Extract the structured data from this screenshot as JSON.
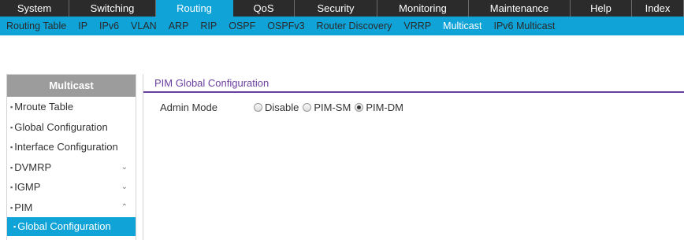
{
  "top_nav": {
    "tabs": [
      {
        "label": "System"
      },
      {
        "label": "Switching"
      },
      {
        "label": "Routing"
      },
      {
        "label": "QoS"
      },
      {
        "label": "Security"
      },
      {
        "label": "Monitoring"
      },
      {
        "label": "Maintenance"
      },
      {
        "label": "Help"
      },
      {
        "label": "Index"
      }
    ],
    "active": "Routing"
  },
  "sub_nav": {
    "items": [
      {
        "label": "Routing Table"
      },
      {
        "label": "IP"
      },
      {
        "label": "IPv6"
      },
      {
        "label": "VLAN"
      },
      {
        "label": "ARP"
      },
      {
        "label": "RIP"
      },
      {
        "label": "OSPF"
      },
      {
        "label": "OSPFv3"
      },
      {
        "label": "Router Discovery"
      },
      {
        "label": "VRRP"
      },
      {
        "label": "Multicast"
      },
      {
        "label": "IPv6 Multicast"
      }
    ],
    "active": "Multicast"
  },
  "sidebar": {
    "title": "Multicast",
    "items": [
      {
        "label": "Mroute Table",
        "chevron": ""
      },
      {
        "label": "Global Configuration",
        "chevron": ""
      },
      {
        "label": "Interface Configuration",
        "chevron": ""
      },
      {
        "label": "DVMRP",
        "chevron": "⌄"
      },
      {
        "label": "IGMP",
        "chevron": "⌄"
      },
      {
        "label": "PIM",
        "chevron": "⌃"
      },
      {
        "label": "Global Configuration",
        "chevron": ""
      }
    ]
  },
  "main": {
    "section_title": "PIM Global Configuration",
    "admin_mode": {
      "label": "Admin Mode",
      "options": [
        "Disable",
        "PIM-SM",
        "PIM-DM"
      ],
      "selected": "PIM-DM"
    }
  },
  "colors": {
    "accent": "#0fa3d8",
    "nav_bg": "#2b2b2b",
    "section_title": "#6b3fa0",
    "sidebar_header": "#9c9c9c"
  }
}
